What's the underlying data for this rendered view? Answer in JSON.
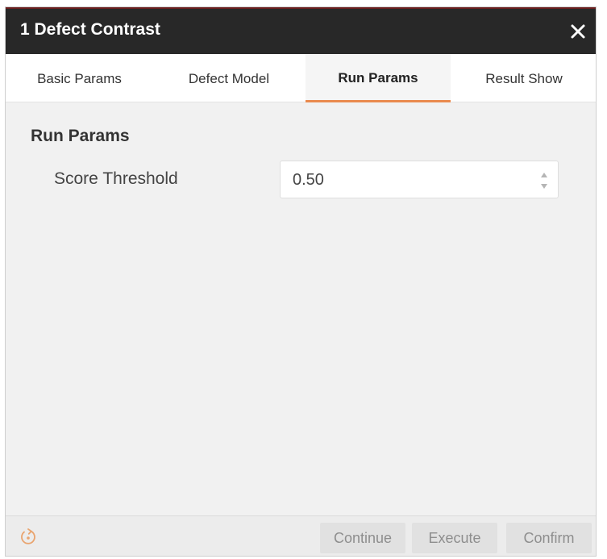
{
  "dialog": {
    "title": "1 Defect Contrast",
    "close_icon": "close-icon"
  },
  "tabs": [
    {
      "label": "Basic Params",
      "active": false
    },
    {
      "label": "Defect Model",
      "active": false
    },
    {
      "label": "Run Params",
      "active": true
    },
    {
      "label": "Result Show",
      "active": false
    }
  ],
  "run_params": {
    "section_title": "Run Params",
    "score_threshold_label": "Score Threshold",
    "score_threshold_value": "0.50"
  },
  "footer": {
    "refresh_icon": "refresh-icon",
    "continue_label": "Continue",
    "execute_label": "Execute",
    "confirm_label": "Confirm"
  },
  "colors": {
    "titlebar": "#282828",
    "title_accent": "#6a1f1f",
    "active_tab_underline": "#e98a4e",
    "refresh_icon": "#e9a46f"
  }
}
